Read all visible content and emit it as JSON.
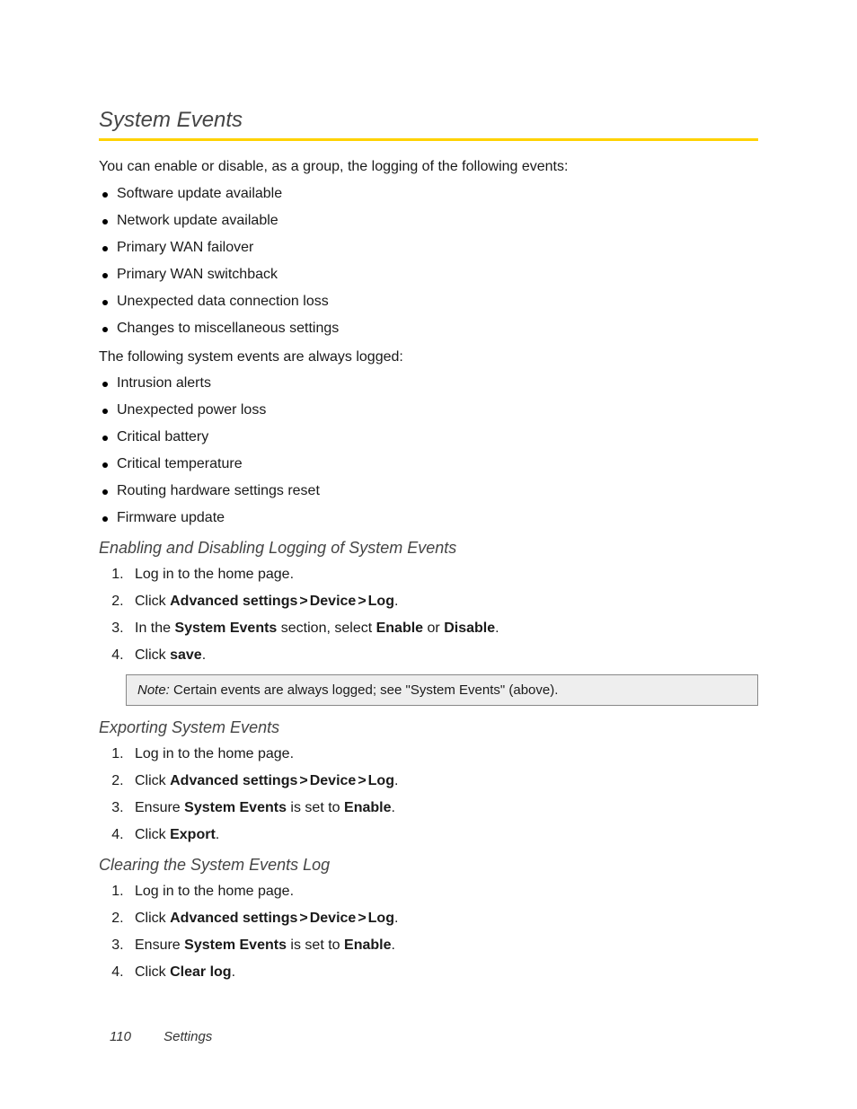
{
  "heading": "System Events",
  "intro": "You can enable or disable, as a group, the logging of the following events:",
  "toggleable": [
    "Software update available",
    "Network update available",
    "Primary WAN failover",
    "Primary WAN switchback",
    "Unexpected data connection loss",
    "Changes to miscellaneous settings"
  ],
  "always_intro": "The following system events are always logged:",
  "always": [
    "Intrusion alerts",
    "Unexpected power loss",
    "Critical battery",
    "Critical temperature",
    "Routing hardware settings reset",
    "Firmware update"
  ],
  "sections": {
    "enable": {
      "title": "Enabling and Disabling Logging of System Events",
      "step1": "Log in to the home page.",
      "step2a": "Click ",
      "step2_adv": "Advanced settings",
      "step2_dev": "Device",
      "step2_log": "Log",
      "step2_end": ".",
      "step3a": "In the ",
      "step3_se": "System Events",
      "step3b": " section, select ",
      "step3_en": "Enable",
      "step3c": " or ",
      "step3_dis": "Disable",
      "step3_end": ".",
      "step4a": "Click ",
      "step4_save": "save",
      "step4_end": "."
    },
    "note": {
      "label": "Note:",
      "text": "  Certain events are always logged; see \"System Events\" (above)."
    },
    "export": {
      "title": "Exporting System Events",
      "step1": "Log in to the home page.",
      "step3a": "Ensure ",
      "step3_se": "System Events",
      "step3b": " is set to ",
      "step3_en": "Enable",
      "step3_end": ".",
      "step4a": "Click ",
      "step4_exp": "Export",
      "step4_end": "."
    },
    "clear": {
      "title": "Clearing the System Events Log",
      "step1": "Log in to the home page.",
      "step4a": "Click ",
      "step4_cl": "Clear log",
      "step4_end": "."
    }
  },
  "gt": ">",
  "footer": {
    "page": "110",
    "section": "Settings"
  }
}
